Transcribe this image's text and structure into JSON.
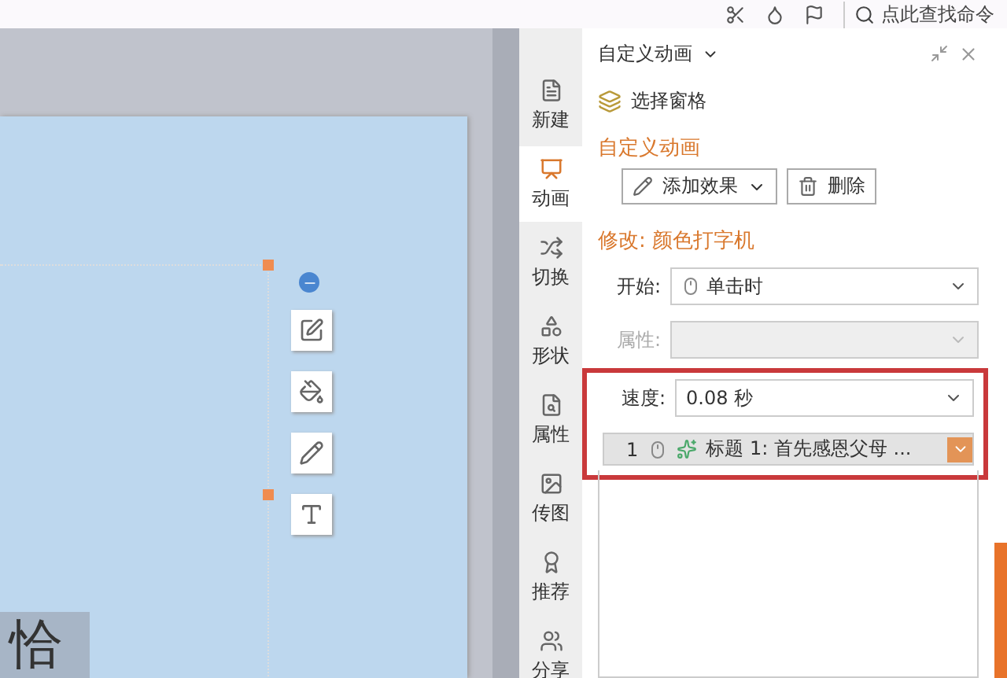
{
  "search": {
    "placeholder": "点此查找命令"
  },
  "slide": {
    "text": "恰"
  },
  "sidebar": {
    "items": [
      {
        "label": "新建",
        "selected": false
      },
      {
        "label": "动画",
        "selected": true
      },
      {
        "label": "切换",
        "selected": false
      },
      {
        "label": "形状",
        "selected": false
      },
      {
        "label": "属性",
        "selected": false
      },
      {
        "label": "传图",
        "selected": false
      },
      {
        "label": "推荐",
        "selected": false
      },
      {
        "label": "分享",
        "selected": false
      }
    ]
  },
  "panel": {
    "title": "自定义动画",
    "select_pane": "选择窗格",
    "section_title": "自定义动画",
    "buttons": [
      {
        "label": "添加效果",
        "kind": "add"
      },
      {
        "label": "删除",
        "kind": "delete"
      }
    ],
    "modify_title": "修改: 颜色打字机",
    "fields": [
      {
        "label": "开始:",
        "value": "单击时",
        "kind": "mouse",
        "disabled": false
      },
      {
        "label": "属性:",
        "kind": "plain",
        "disabled": true
      },
      {
        "label": "速度:",
        "value": "0.08 秒",
        "kind": "plain",
        "disabled": false
      }
    ],
    "list": [
      {
        "number": "1",
        "text": "标题 1: 首先感恩父母 ...",
        "selected": true
      }
    ]
  }
}
